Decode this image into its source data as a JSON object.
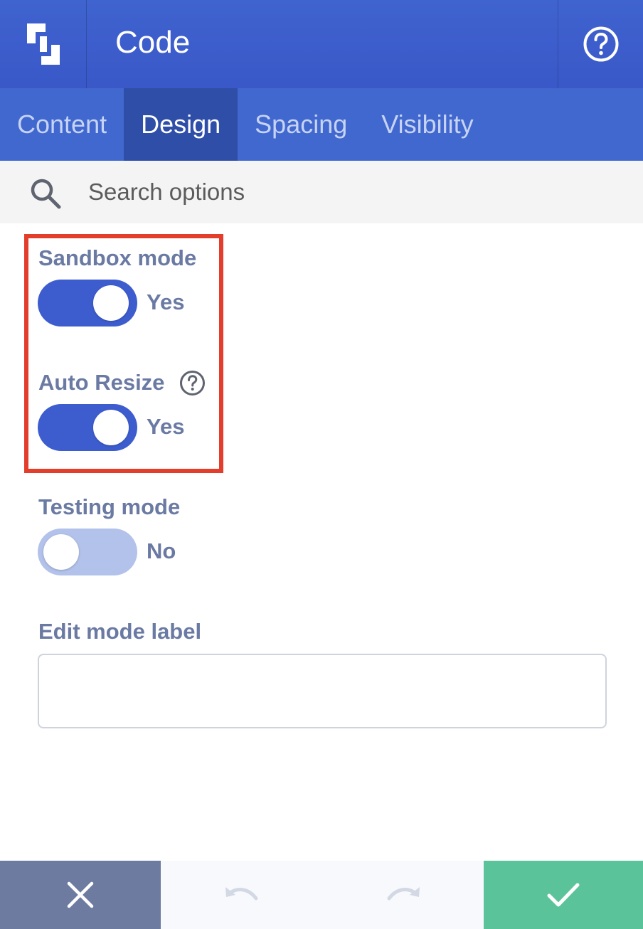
{
  "header": {
    "title": "Code"
  },
  "tabs": [
    {
      "label": "Content",
      "active": false
    },
    {
      "label": "Design",
      "active": true
    },
    {
      "label": "Spacing",
      "active": false
    },
    {
      "label": "Visibility",
      "active": false
    }
  ],
  "search": {
    "placeholder": "Search options"
  },
  "options": {
    "sandbox_mode": {
      "label": "Sandbox mode",
      "value": "Yes",
      "on": true
    },
    "auto_resize": {
      "label": "Auto Resize",
      "value": "Yes",
      "on": true
    },
    "testing_mode": {
      "label": "Testing mode",
      "value": "No",
      "on": false
    },
    "edit_mode_label": {
      "label": "Edit mode label",
      "value": ""
    }
  },
  "colors": {
    "header": "#3a58c8",
    "active_tab": "#2f4ea8",
    "toggle_on": "#3d5dcf",
    "toggle_off": "#b3c2ea",
    "highlight": "#e33e2b",
    "cancel": "#6d7ba0",
    "confirm": "#5bc39a"
  },
  "icons": {
    "logo": "builder-logo-icon",
    "help": "question-circle-icon",
    "search": "search-icon",
    "info": "question-circle-icon",
    "cancel": "close-icon",
    "undo": "undo-icon",
    "redo": "redo-icon",
    "confirm": "check-icon"
  }
}
